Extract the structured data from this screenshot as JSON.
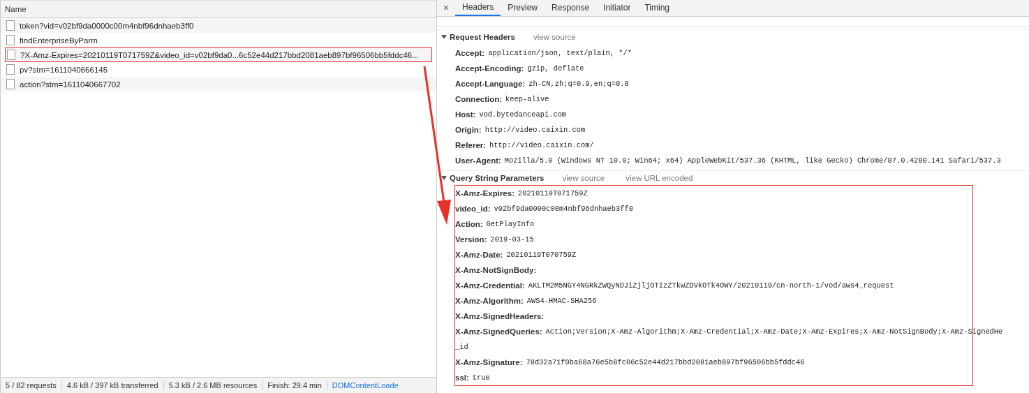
{
  "requests_panel": {
    "column_header": "Name",
    "rows": [
      {
        "name": "token?vid=v02bf9da0000c00m4nbf96dnhaeb3ff0",
        "highlighted": false
      },
      {
        "name": "findEnterpriseByParm",
        "highlighted": false
      },
      {
        "name": "?X-Amz-Expires=20210119T071759Z&video_id=v02bf9da0...6c52e44d217bbd2081aeb897bf96506bb5fddc46...",
        "highlighted": true
      },
      {
        "name": "pv?stm=1611040666145",
        "highlighted": false
      },
      {
        "name": "action?stm=1611040667702",
        "highlighted": false
      }
    ]
  },
  "status_bar": [
    {
      "text": "5 / 82 requests",
      "kind": "plain"
    },
    {
      "text": "4.6 kB / 397 kB transferred",
      "kind": "plain"
    },
    {
      "text": "5.3 kB / 2.6 MB resources",
      "kind": "plain"
    },
    {
      "text": "Finish: 29.4 min",
      "kind": "plain"
    },
    {
      "text": "DOMContentLoade",
      "kind": "link"
    }
  ],
  "details_panel": {
    "close": "×",
    "tabs": [
      {
        "label": "Headers",
        "selected": true
      },
      {
        "label": "Preview",
        "selected": false
      },
      {
        "label": "Response",
        "selected": false
      },
      {
        "label": "Initiator",
        "selected": false
      },
      {
        "label": "Timing",
        "selected": false
      }
    ],
    "sections": [
      {
        "title": "Request Headers",
        "expanded": true,
        "links": [
          "view source"
        ],
        "rows": [
          {
            "key": "Accept:",
            "value": [
              "application/json, text/plain, */*"
            ]
          },
          {
            "key": "Accept-Encoding:",
            "value": [
              "gzip, deflate"
            ]
          },
          {
            "key": "Accept-Language:",
            "value": [
              "zh-CN,zh;q=0.9,en;q=0.8"
            ]
          },
          {
            "key": "Connection:",
            "value": [
              "keep-alive"
            ]
          },
          {
            "key": "Host:",
            "value": [
              "vod.bytedanceapi.com"
            ]
          },
          {
            "key": "Origin:",
            "value": [
              "http://video.caixin.com"
            ]
          },
          {
            "key": "Referer:",
            "value": [
              "http://video.caixin.com/"
            ]
          },
          {
            "key": "User-Agent:",
            "value": [
              "Mozilla/5.0 (Windows NT 10.0; Win64; x64) AppleWebKit/537.36 (KHTML, like Gecko) Chrome/87.0.4280.141 Safari/537.3"
            ]
          }
        ]
      },
      {
        "title": "Query String Parameters",
        "expanded": true,
        "highlighted": true,
        "links": [
          "view source",
          "view URL encoded"
        ],
        "rows": [
          {
            "key": "X-Amz-Expires:",
            "value": [
              "20210119T071759Z"
            ]
          },
          {
            "key": "video_id:",
            "value": [
              "v02bf9da0000c00m4nbf96dnhaeb3ff0"
            ]
          },
          {
            "key": "Action:",
            "value": [
              "GetPlayInfo"
            ]
          },
          {
            "key": "Version:",
            "value": [
              "2019-03-15"
            ]
          },
          {
            "key": "X-Amz-Date:",
            "value": [
              "20210119T070759Z"
            ]
          },
          {
            "key": "X-Amz-NotSignBody:",
            "value": []
          },
          {
            "key": "X-Amz-Credential:",
            "value": [
              "AKLTM2M5NGY4NGRkZWQyNDJiZjljOTIzZTkwZDVkOTk4OWY/20210119/cn-north-1/vod/aws4_request"
            ]
          },
          {
            "key": "X-Amz-Algorithm:",
            "value": [
              "AWS4-HMAC-SHA256"
            ]
          },
          {
            "key": "X-Amz-SignedHeaders:",
            "value": []
          },
          {
            "key": "X-Amz-SignedQueries:",
            "value": [
              "Action;Version;X-Amz-Algorithm;X-Amz-Credential;X-Amz-Date;X-Amz-Expires;X-Amz-NotSignBody;X-Amz-SignedHe",
              "_id"
            ]
          },
          {
            "key": "X-Amz-Signature:",
            "value": [
              "78d32a71f0ba68a76e5b8fc06c52e44d217bbd2081aeb897bf96506bb5fddc46"
            ]
          },
          {
            "key": "ssl:",
            "value": [
              "true"
            ]
          }
        ]
      }
    ]
  }
}
